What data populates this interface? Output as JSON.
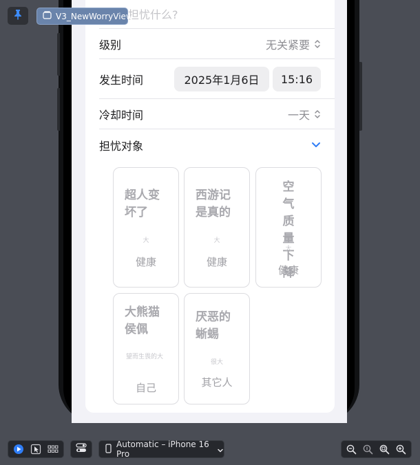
{
  "overlay": {
    "view_name": "V3_NewWorryView"
  },
  "form": {
    "question_placeholder": "担忧什么?",
    "level": {
      "label": "级别",
      "value": "无关紧要"
    },
    "time": {
      "label": "发生时间",
      "date": "2025年1月6日",
      "clock": "15:16"
    },
    "cooldown": {
      "label": "冷却时间",
      "value": "一天"
    },
    "target": {
      "label": "担忧对象"
    }
  },
  "tiles": [
    {
      "title": "超人变坏了",
      "size": "大",
      "category": "健康"
    },
    {
      "title": "西游记是真的",
      "size": "大",
      "category": "健康"
    },
    {
      "title": "空气质量下降",
      "size": "大",
      "category": "健康"
    },
    {
      "title": "大熊猫侯佩",
      "size": "望而生畏的大",
      "category": "自己"
    },
    {
      "title": "厌恶的蜥蜴",
      "size": "很大",
      "category": "其它人"
    }
  ],
  "toolbar": {
    "device": "Automatic – iPhone 16 Pro"
  },
  "colors": {
    "accent": "#2f7df6",
    "canvas": "#4a4d55",
    "badge": "#6a84ab"
  }
}
